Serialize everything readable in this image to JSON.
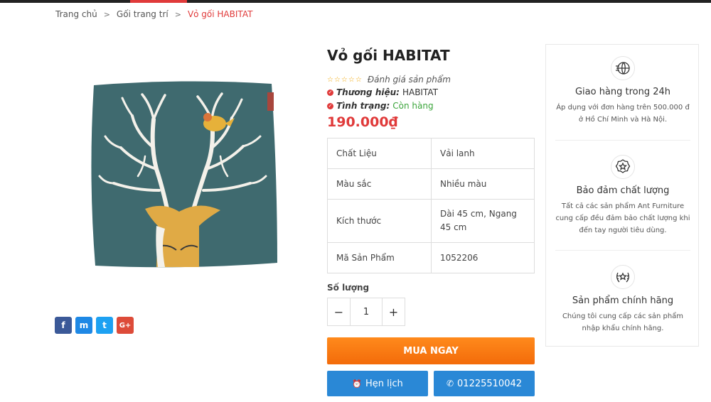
{
  "breadcrumb": {
    "home": "Trang chủ",
    "category": "Gối trang trí",
    "current": "Vỏ gối HABITAT",
    "separator": ">"
  },
  "product": {
    "title": "Vỏ gối HABITAT",
    "stars": "☆☆☆☆☆",
    "rating_label": "Đánh giá sản phẩm",
    "brand_label": "Thương hiệu:",
    "brand_value": "HABITAT",
    "status_label": "Tình trạng:",
    "status_value": "Còn hàng",
    "price": "190.000₫",
    "specs": [
      {
        "key": "Chất Liệu",
        "value": "Vải lanh"
      },
      {
        "key": "Màu sắc",
        "value": "Nhiều màu"
      },
      {
        "key": "Kích thước",
        "value": "Dài 45 cm, Ngang 45 cm"
      },
      {
        "key": "Mã Sản Phẩm",
        "value": "1052206"
      }
    ],
    "quantity_label": "Số lượng",
    "quantity_value": "1",
    "minus": "−",
    "plus": "+"
  },
  "actions": {
    "buy_now": "MUA NGAY",
    "schedule": "Hẹn lịch",
    "phone": "01225510042"
  },
  "share": {
    "facebook": "f",
    "messenger": "m",
    "twitter": "t",
    "google": "G+"
  },
  "features": [
    {
      "icon": "globe-delivery-icon",
      "title": "Giao hàng trong 24h",
      "desc": "Áp dụng với đơn hàng trên 500.000 đ ở Hồ Chí Minh và Hà Nội."
    },
    {
      "icon": "quality-badge-icon",
      "title": "Bảo đảm chất lượng",
      "desc": "Tất cả các sản phẩm Ant Furniture cung cấp đều đảm bảo chất lượng khi đến tay người tiêu dùng."
    },
    {
      "icon": "laurel-star-icon",
      "title": "Sản phẩm chính hãng",
      "desc": "Chúng tôi cung cấp các sản phẩm nhập khẩu chính hãng."
    }
  ],
  "colors": {
    "accent_red": "#e03a3a",
    "buy_orange": "#f57c12",
    "cta_blue": "#2a88d6",
    "in_stock_green": "#3ba53b"
  }
}
